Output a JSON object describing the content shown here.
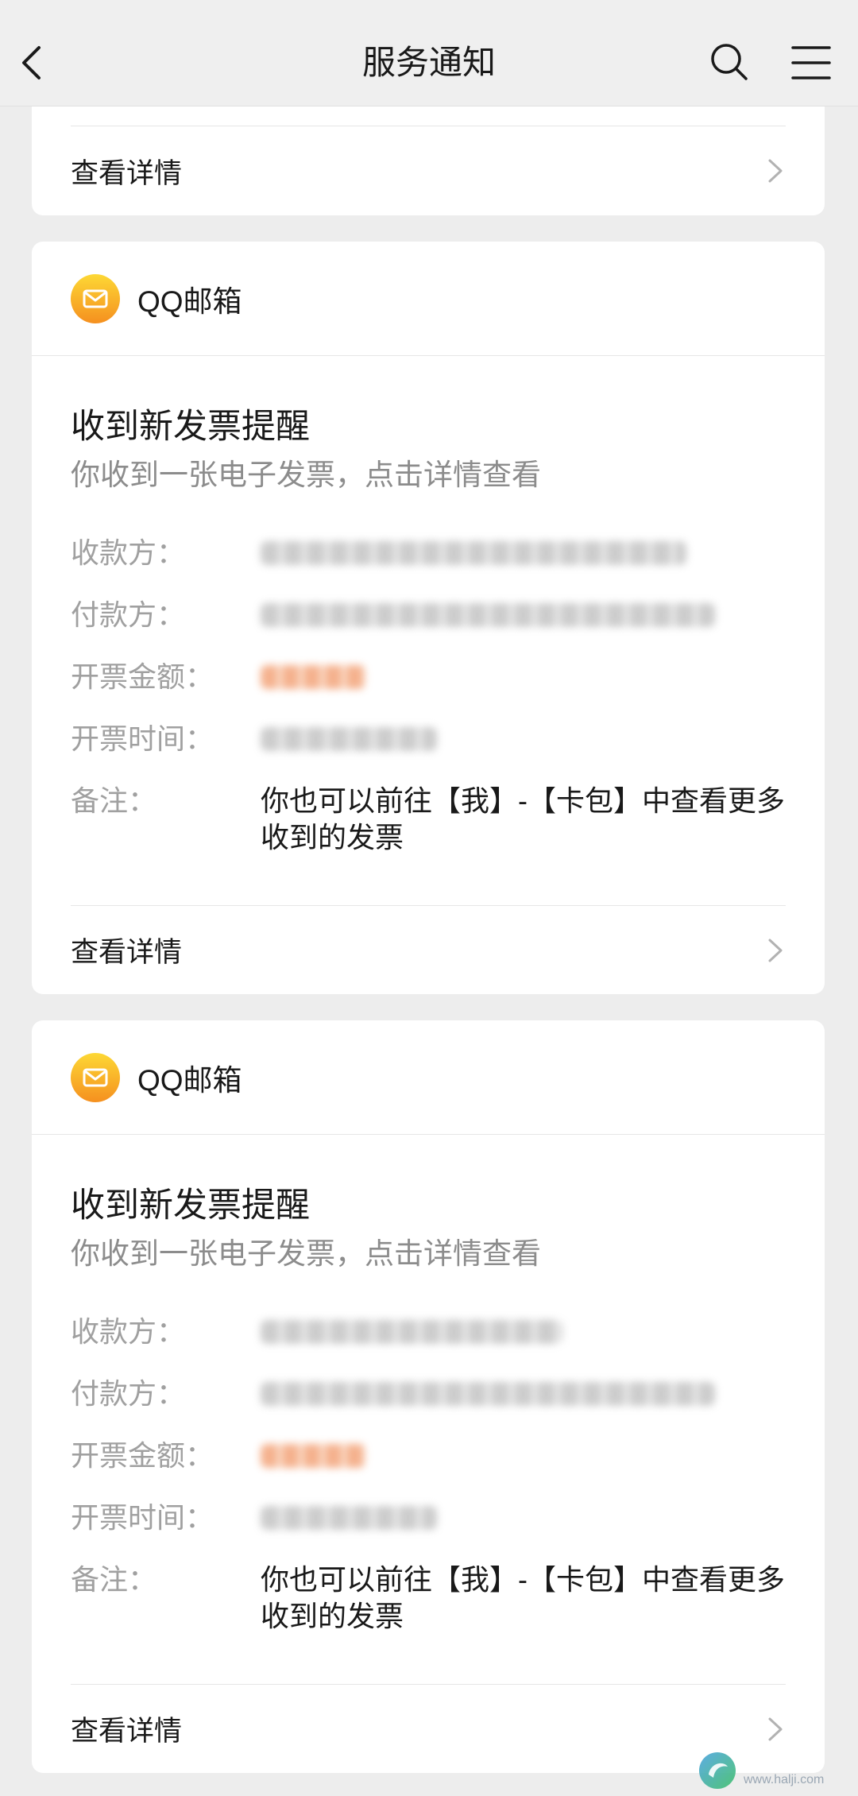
{
  "header": {
    "title": "服务通知",
    "back_icon": "back-chevron-icon",
    "search_icon": "search-icon",
    "menu_icon": "menu-icon"
  },
  "top_card": {
    "footer_label": "查看详情",
    "footer_icon": "chevron-right-icon"
  },
  "cards": [
    {
      "source": "QQ邮箱",
      "source_icon": "qq-mail-icon",
      "title": "收到新发票提醒",
      "subtitle": "你收到一张电子发票，点击详情查看",
      "fields": [
        {
          "label": "收款方："
        },
        {
          "label": "付款方："
        },
        {
          "label": "开票金额："
        },
        {
          "label": "开票时间："
        },
        {
          "label": "备注：",
          "value": [
            "你也可以前往【我】-【卡包】中查看更多",
            "收到的发票"
          ]
        }
      ],
      "footer_label": "查看详情",
      "footer_icon": "chevron-right-icon"
    },
    {
      "source": "QQ邮箱",
      "source_icon": "qq-mail-icon",
      "title": "收到新发票提醒",
      "subtitle": "你收到一张电子发票，点击详情查看",
      "fields": [
        {
          "label": "收款方："
        },
        {
          "label": "付款方："
        },
        {
          "label": "开票金额："
        },
        {
          "label": "开票时间："
        },
        {
          "label": "备注：",
          "value": [
            "你也可以前往【我】-【卡包】中查看更多",
            "收到的发票"
          ]
        }
      ],
      "footer_label": "查看详情",
      "footer_icon": "chevron-right-icon"
    }
  ],
  "watermark": {
    "text": "www.halji.com",
    "logo_icon": "site-logo-icon"
  },
  "colors": {
    "page_bg": "#ededed",
    "card_bg": "#ffffff",
    "text": "#191919",
    "label": "#a0a0a0",
    "subtitle": "#8c8c8c",
    "value_blur": "#c4c4c4",
    "amount_blur": "#f3a47a",
    "chevron": "#b2b2b2",
    "mail_icon_top": "#fdd835",
    "mail_icon_bottom": "#f5901f"
  }
}
